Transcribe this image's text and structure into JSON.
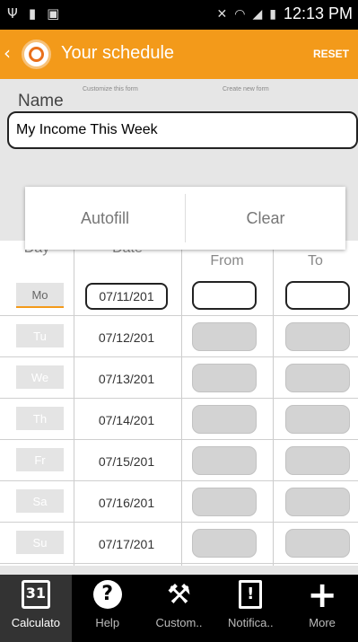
{
  "status_bar": {
    "time": "12:13 PM"
  },
  "action_bar": {
    "back": "‹",
    "title": "Your schedule",
    "reset": "RESET"
  },
  "form": {
    "name_label": "Name",
    "customize_link": "Customize this form",
    "create_link": "Create new form",
    "name_value": "My Income This Week"
  },
  "popup": {
    "autofill": "Autofill",
    "clear": "Clear"
  },
  "table": {
    "headers": {
      "day": "Day",
      "date": "Date",
      "from": "From",
      "to": "To"
    },
    "rows": [
      {
        "day": "Mo",
        "date": "07/11/201"
      },
      {
        "day": "Tu",
        "date": "07/12/201"
      },
      {
        "day": "We",
        "date": "07/13/201"
      },
      {
        "day": "Th",
        "date": "07/14/201"
      },
      {
        "day": "Fr",
        "date": "07/15/201"
      },
      {
        "day": "Sa",
        "date": "07/16/201"
      },
      {
        "day": "Su",
        "date": "07/17/201"
      }
    ]
  },
  "nav": {
    "items": [
      {
        "label": "Calculato",
        "icon": "calendar-icon",
        "glyph": "31"
      },
      {
        "label": "Help",
        "icon": "help-icon",
        "glyph": "?"
      },
      {
        "label": "Custom..",
        "icon": "tools-icon",
        "glyph": "⚒"
      },
      {
        "label": "Notifica..",
        "icon": "notification-icon",
        "glyph": "!"
      },
      {
        "label": "More",
        "icon": "plus-icon",
        "glyph": "+"
      }
    ]
  },
  "colors": {
    "accent": "#f39a1a",
    "header_bg": "#e6e6e6",
    "nav_bg": "#000000"
  }
}
